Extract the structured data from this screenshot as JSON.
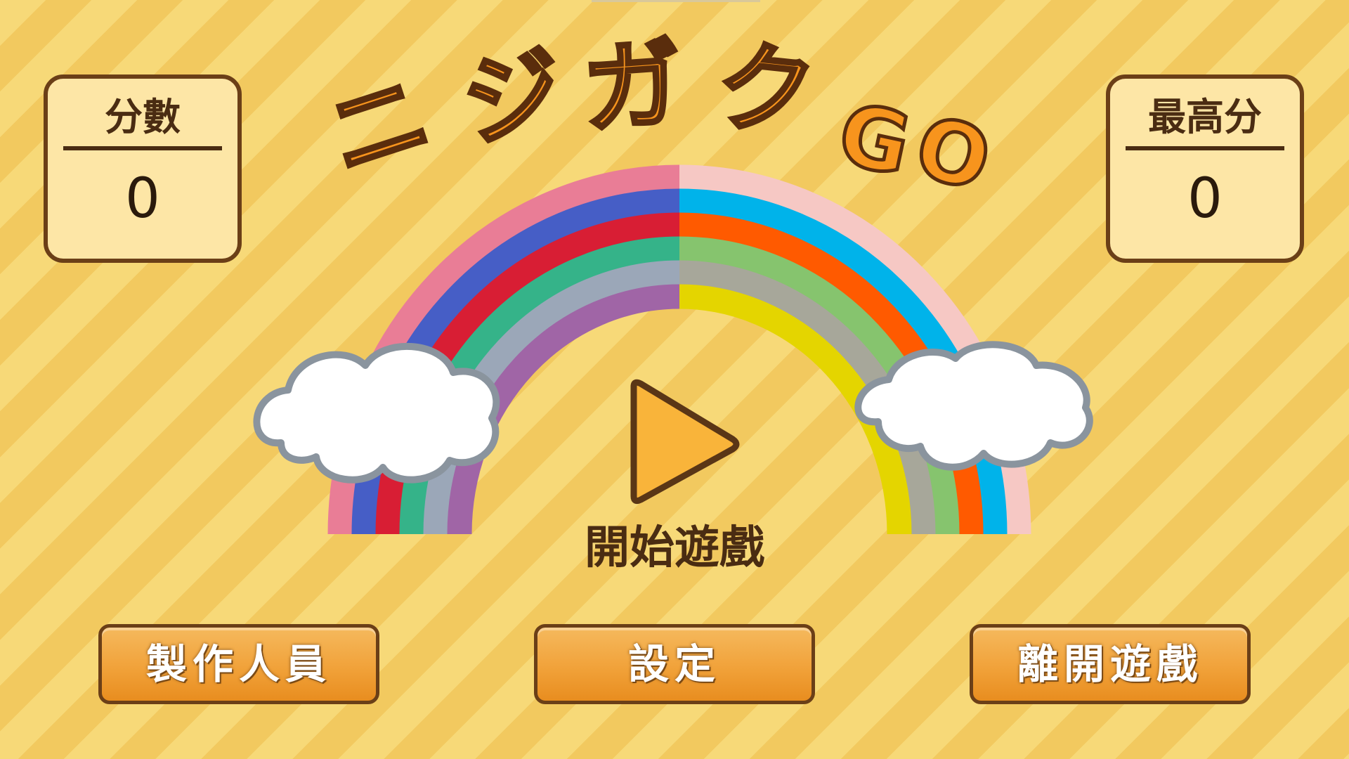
{
  "title": {
    "chars": [
      "ニ",
      "ジ",
      "ガ",
      "ク",
      "G",
      "O"
    ]
  },
  "score": {
    "label": "分數",
    "value": "0"
  },
  "high_score": {
    "label": "最高分",
    "value": "0"
  },
  "play": {
    "label": "開始遊戲",
    "icon": "play-icon"
  },
  "menu": {
    "credits_label": "製作人員",
    "settings_label": "設定",
    "quit_label": "離開遊戲"
  },
  "colors": {
    "background_light": "#f7d978",
    "background_stripe": "#f2c95f",
    "title_fill": "#f7941d",
    "outline": "#5a2d0c",
    "button_orange": "#f1a23a",
    "rainbow_left": [
      "#e97d96",
      "#465ec6",
      "#d81e34",
      "#35b389",
      "#9ba7b8",
      "#a065a6"
    ],
    "rainbow_right": [
      "#f6c8c4",
      "#00b3ea",
      "#ff5a00",
      "#86c46e",
      "#a7a79a",
      "#e4d500"
    ]
  }
}
